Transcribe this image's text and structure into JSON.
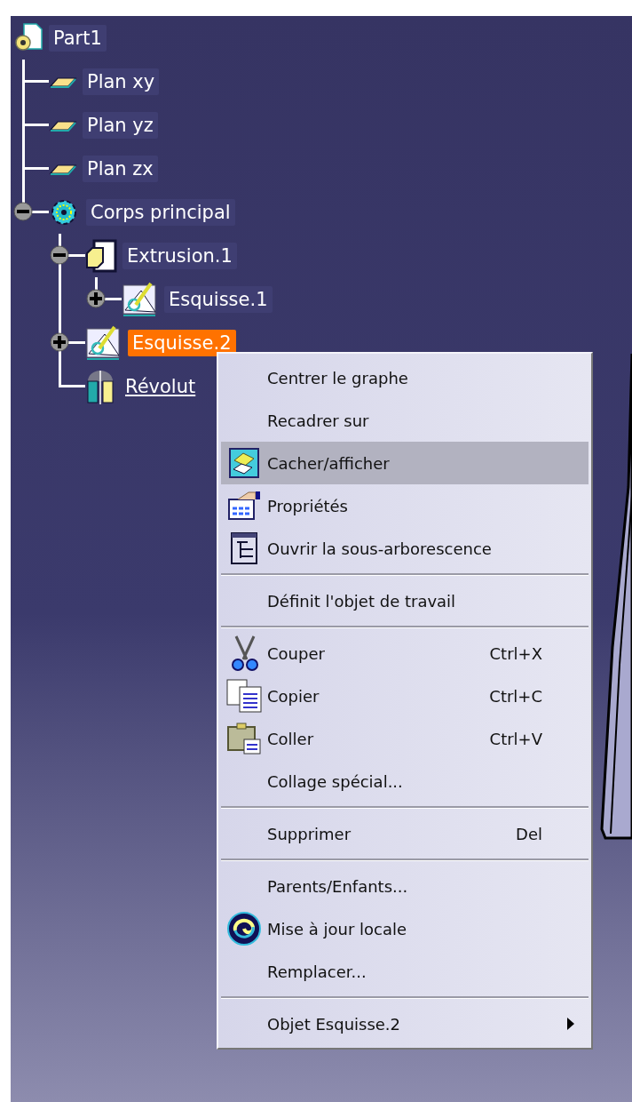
{
  "tree": {
    "label": "Part1",
    "kind": "part",
    "selected": false,
    "hovered": false,
    "children": [
      {
        "label": "Plan xy",
        "kind": "plane",
        "selected": false,
        "hovered": false
      },
      {
        "label": "Plan yz",
        "kind": "plane",
        "selected": false,
        "hovered": false
      },
      {
        "label": "Plan zx",
        "kind": "plane",
        "selected": false,
        "hovered": false
      },
      {
        "label": "Corps principal",
        "kind": "body",
        "selected": false,
        "hovered": false,
        "expanded": true,
        "children": [
          {
            "label": "Extrusion.1",
            "kind": "extrusion",
            "selected": false,
            "hovered": false,
            "expanded": true,
            "children": [
              {
                "label": "Esquisse.1",
                "kind": "sketch",
                "selected": false,
                "hovered": false,
                "expanded": false
              }
            ]
          },
          {
            "label": "Esquisse.2",
            "kind": "sketch",
            "selected": true,
            "hovered": false,
            "expanded": false
          },
          {
            "label": "Révolut",
            "kind": "revolve",
            "selected": false,
            "hovered": true
          }
        ]
      }
    ]
  },
  "context_menu": {
    "items": [
      {
        "kind": "item",
        "label": "Centrer le graphe",
        "selected": false
      },
      {
        "kind": "item",
        "label": "Recadrer sur",
        "selected": false
      },
      {
        "kind": "item",
        "label": "Cacher/afficher",
        "selected": true
      },
      {
        "kind": "item",
        "label": "Propriétés",
        "selected": false
      },
      {
        "kind": "item",
        "label": "Ouvrir la sous-arborescence",
        "selected": false
      },
      {
        "kind": "separator"
      },
      {
        "kind": "item",
        "label": "Définit l'objet de travail",
        "selected": false
      },
      {
        "kind": "separator"
      },
      {
        "kind": "item",
        "label": "Couper",
        "shortcut": "Ctrl+X",
        "selected": false
      },
      {
        "kind": "item",
        "label": "Copier",
        "shortcut": "Ctrl+C",
        "selected": false
      },
      {
        "kind": "item",
        "label": "Coller",
        "shortcut": "Ctrl+V",
        "selected": false
      },
      {
        "kind": "item",
        "label": "Collage spécial...",
        "selected": false
      },
      {
        "kind": "separator"
      },
      {
        "kind": "item",
        "label": "Supprimer",
        "shortcut": "Del",
        "selected": false
      },
      {
        "kind": "separator"
      },
      {
        "kind": "item",
        "label": "Parents/Enfants...",
        "selected": false
      },
      {
        "kind": "item",
        "label": "Mise à jour locale",
        "selected": false
      },
      {
        "kind": "item",
        "label": "Remplacer...",
        "selected": false
      },
      {
        "kind": "separator"
      },
      {
        "kind": "submenu",
        "label": "Objet Esquisse.2",
        "selected": false
      }
    ]
  }
}
